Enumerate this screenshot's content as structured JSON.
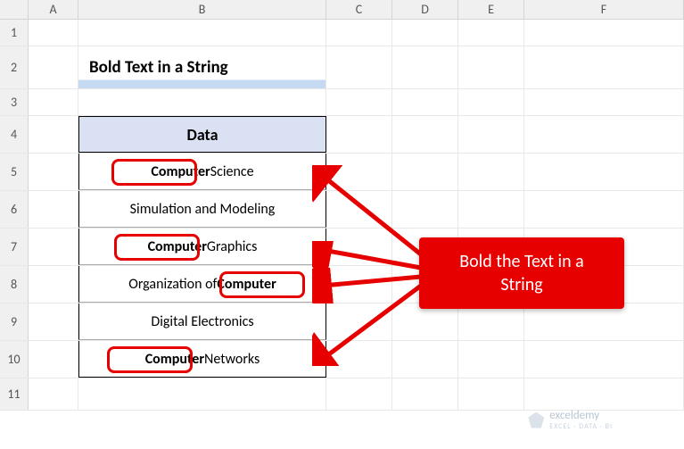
{
  "columns": [
    "A",
    "B",
    "C",
    "D",
    "E",
    "F"
  ],
  "rows": [
    "1",
    "2",
    "3",
    "4",
    "5",
    "6",
    "7",
    "8",
    "9",
    "10",
    "11"
  ],
  "title": "Bold Text in a String",
  "table_header": "Data",
  "data_rows": [
    {
      "prefix": "",
      "bold": "Computer",
      "suffix": " Science",
      "highlight": true
    },
    {
      "prefix": "Simulation and Modeling",
      "bold": "",
      "suffix": "",
      "highlight": false
    },
    {
      "prefix": "",
      "bold": "Computer",
      "suffix": " Graphics",
      "highlight": true
    },
    {
      "prefix": "Organization of ",
      "bold": "Computer",
      "suffix": "",
      "highlight": true
    },
    {
      "prefix": "Digital Electronics",
      "bold": "",
      "suffix": "",
      "highlight": false
    },
    {
      "prefix": "",
      "bold": "Computer",
      "suffix": " Networks",
      "highlight": true
    }
  ],
  "callout_text_line1": "Bold the Text in a",
  "callout_text_line2": "String",
  "watermark_main": "exceldemy",
  "watermark_sub": "EXCEL · DATA · BI"
}
